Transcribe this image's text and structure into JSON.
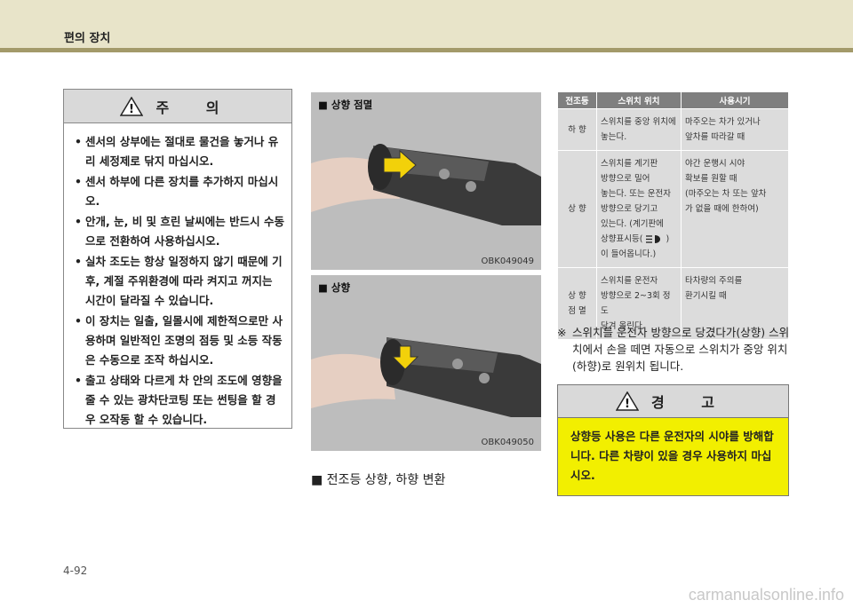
{
  "header": {
    "title": "편의 장치"
  },
  "caution": {
    "title": "주  의",
    "items": [
      "센서의 상부에는 절대로 물건을 놓거나 유리 세정제로 닦지 마십시오.",
      "센서 하부에 다른 장치를 추가하지 마십시오.",
      "안개, 눈, 비 및 흐린 날씨에는 반드시 수동으로 전환하여 사용하십시오.",
      "실차 조도는 항상 일정하지 않기 때문에 기후, 계절 주위환경에 따라 켜지고 꺼지는 시간이 달라질 수 있습니다.",
      "이 장치는 일출, 일몰시에 제한적으로만 사용하며 일반적인 조명의 점등 및 소등 작동은 수동으로 조작 하십시오.",
      "출고 상태와 다르게 차 안의 조도에 영향을 줄 수 있는 광차단코팅 또는 썬팅을 할 경우 오작동 할 수 있습니다."
    ]
  },
  "photos": [
    {
      "title": "■  상향 점멸",
      "code": "OBK049049"
    },
    {
      "title": "■  상향",
      "code": "OBK049050"
    }
  ],
  "caption": "■ 전조등 상향, 하향 변환",
  "table": {
    "headers": [
      "전조등",
      "스위치 위치",
      "사용시기"
    ],
    "rows": [
      {
        "mode": "하 향",
        "position": [
          "스위치를 중앙 위치에",
          "놓는다."
        ],
        "usage": [
          "마주오는 차가 있거나",
          "앞차를 따라갈 때"
        ]
      },
      {
        "mode": "상 향",
        "position": [
          "스위치를 계기판",
          "방향으로 밀어",
          "놓는다. 또는 운전자",
          "방향으로 당기고",
          "있는다. (계기판에",
          "상향표시등(",
          "이 들어옵니다.)"
        ],
        "icon_close": ")",
        "usage": [
          "야간 운행시 시야",
          "확보를 원할 때",
          "(마주오는 차 또는 앞차",
          "가 없을 때에 한하여)"
        ]
      },
      {
        "mode_lines": [
          "상 향",
          "점 멸"
        ],
        "position": [
          "스위치를 운전자",
          "방향으로 2~3회 정도",
          "당겨 올린다."
        ],
        "usage": [
          "타차량의 주의를",
          "환기시킬 때"
        ]
      }
    ]
  },
  "note": {
    "mark": "※",
    "text": "스위치를 운전자 방향으로 당겼다가(상향) 스위치에서 손을 떼면 자동으로 스위치가 중앙 위치(하향)로 원위치 됩니다."
  },
  "warning": {
    "title": "경  고",
    "text": "상향등 사용은 다른 운전자의 시야를 방해합니다. 다른 차량이 있을 경우 사용하지 마십시오."
  },
  "page_number": "4-92",
  "watermark": "carmanualsonline.info",
  "colors": {
    "header_bg": "#e8e4c9",
    "header_strip": "#a39a6a",
    "warning_bg": "#f2ef00",
    "table_header": "#7f7f7f",
    "table_cell": "#dcdcdc"
  }
}
